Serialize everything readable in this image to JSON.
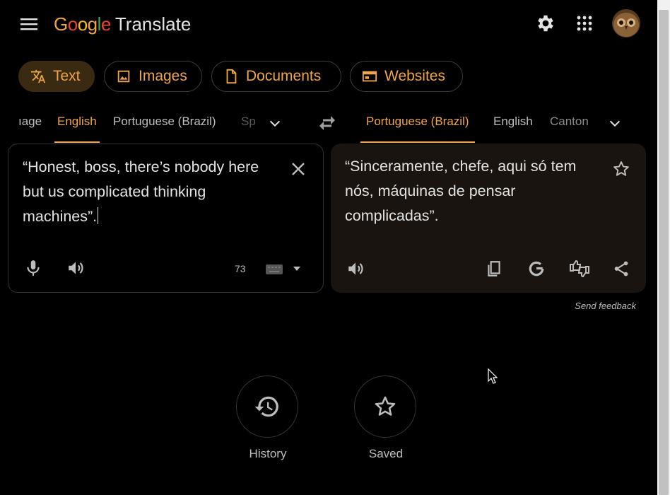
{
  "header": {
    "logo_word": "Google",
    "app_name": "Translate",
    "icons": [
      "menu-icon",
      "gear-icon",
      "apps-grid-icon",
      "avatar"
    ]
  },
  "modes": [
    {
      "label": "Text",
      "icon": "translate-icon",
      "active": true
    },
    {
      "label": "Images",
      "icon": "image-icon",
      "active": false
    },
    {
      "label": "Documents",
      "icon": "document-icon",
      "active": false
    },
    {
      "label": "Websites",
      "icon": "website-icon",
      "active": false
    }
  ],
  "source_langs": {
    "partial_left": "ıage",
    "items": [
      "English",
      "Portuguese (Brazil)"
    ],
    "partial_right": "Sp",
    "selected": "English"
  },
  "target_langs": {
    "items": [
      "Portuguese (Brazil)",
      "English"
    ],
    "partial_right": "Canton",
    "selected": "Portuguese (Brazil)"
  },
  "source": {
    "lines": [
      "“Honest, boss, there’s nobody here",
      "but us complicated thinking",
      "machines”."
    ],
    "char_count": "73"
  },
  "target": {
    "lines": [
      "“Sinceramente, chefe, aqui só tem",
      "nós, máquinas de pensar",
      "complicadas”."
    ]
  },
  "feedback": "Send feedback",
  "bottom": {
    "history_label": "History",
    "saved_label": "Saved"
  },
  "colors": {
    "accent": "#f0a54a",
    "background": "#000000",
    "target_panel": "#19140f"
  }
}
